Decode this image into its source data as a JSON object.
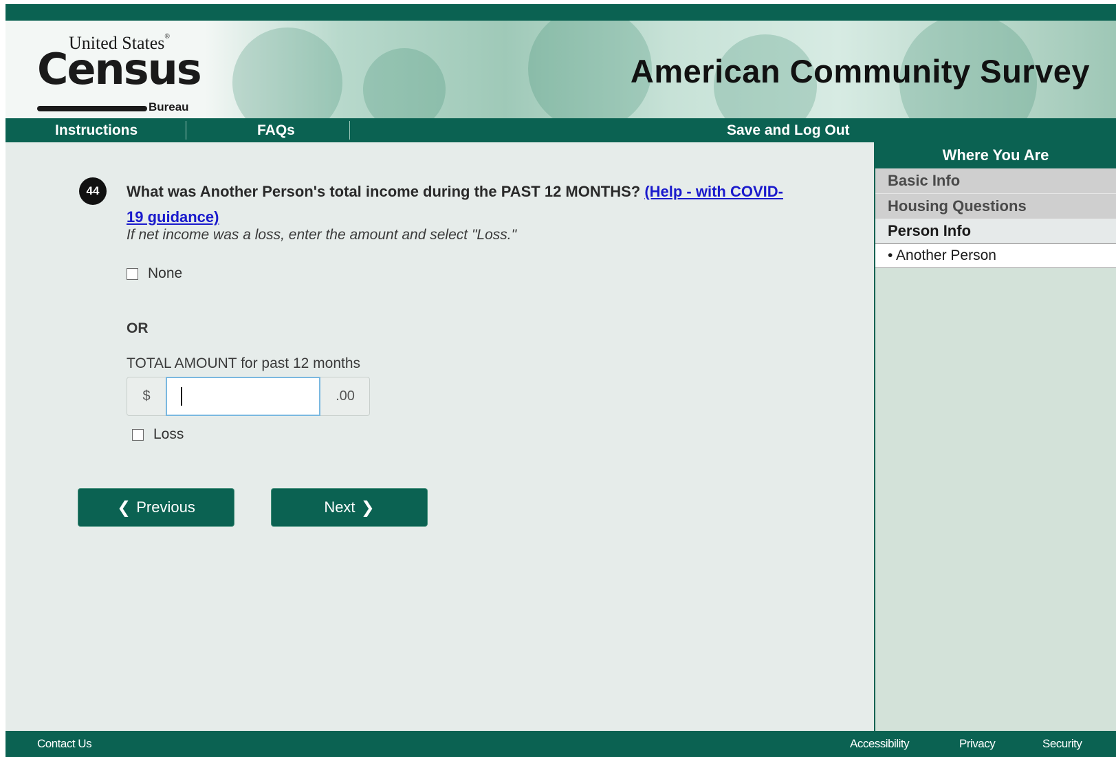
{
  "header": {
    "logo_line1": "United States",
    "logo_reg": "®",
    "logo_main": "Census",
    "logo_line3": "Bureau",
    "survey_title": "American Community Survey"
  },
  "nav": {
    "instructions": "Instructions",
    "faqs": "FAQs",
    "save_logout": "Save and Log Out"
  },
  "question": {
    "number": "44",
    "text": "What was Another Person's total income during the PAST 12 MONTHS? ",
    "help_link": "(Help - with COVID-19 guidance)",
    "instruction": "If net income was a loss, enter the amount and select \"Loss.\""
  },
  "form": {
    "none_label": "None",
    "none_checked": false,
    "or_label": "OR",
    "amount_label": "TOTAL AMOUNT for past 12 months",
    "currency_prefix": "$",
    "amount_value": "",
    "amount_suffix": ".00",
    "loss_label": "Loss",
    "loss_checked": false
  },
  "buttons": {
    "previous": "Previous",
    "next": "Next"
  },
  "sidebar": {
    "title": "Where You Are",
    "sections": [
      {
        "label": "Basic Info",
        "active": false
      },
      {
        "label": "Housing Questions",
        "active": false
      },
      {
        "label": "Person Info",
        "active": true
      }
    ],
    "current_item": "• Another Person"
  },
  "footer": {
    "contact": "Contact Us",
    "accessibility": "Accessibility",
    "privacy": "Privacy",
    "security": "Security"
  },
  "colors": {
    "brand_green": "#0b6252",
    "background": "#e6ecea",
    "link_blue": "#1a1acc",
    "sidebar_bg": "#d3e2d9"
  }
}
